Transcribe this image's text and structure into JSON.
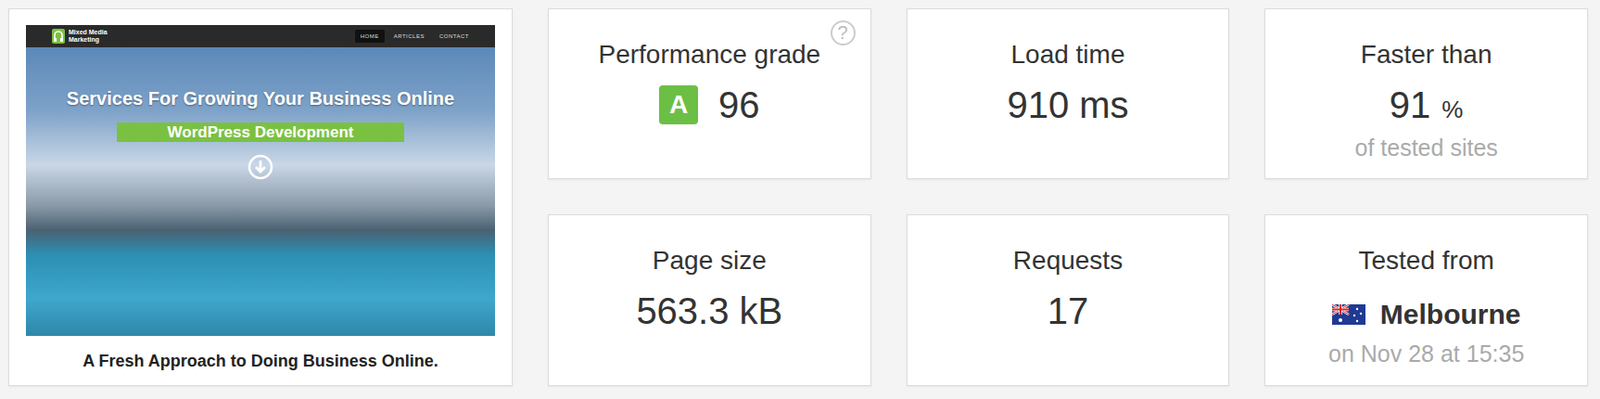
{
  "preview": {
    "logo_lines": [
      "Mixed Media",
      "Marketing"
    ],
    "nav": [
      {
        "label": "HOME",
        "selected": true
      },
      {
        "label": "ARTICLES",
        "selected": false
      },
      {
        "label": "CONTACT",
        "selected": false
      }
    ],
    "headline": "Services For Growing Your Business Online",
    "button": "WordPress Development",
    "caption": "A Fresh Approach to Doing Business Online."
  },
  "metrics": [
    {
      "kind": "grade",
      "label": "Performance grade",
      "grade": "A",
      "value": "96",
      "help": "?"
    },
    {
      "kind": "value",
      "label": "Load time",
      "value": "910 ms"
    },
    {
      "kind": "percent",
      "label": "Faster than",
      "value": "91",
      "unit": "%",
      "sub": "of tested sites"
    },
    {
      "kind": "value",
      "label": "Page size",
      "value": "563.3 kB"
    },
    {
      "kind": "value",
      "label": "Requests",
      "value": "17"
    },
    {
      "kind": "location",
      "label": "Tested from",
      "value": "Melbourne",
      "sub": "on Nov 28 at 15:35"
    }
  ]
}
